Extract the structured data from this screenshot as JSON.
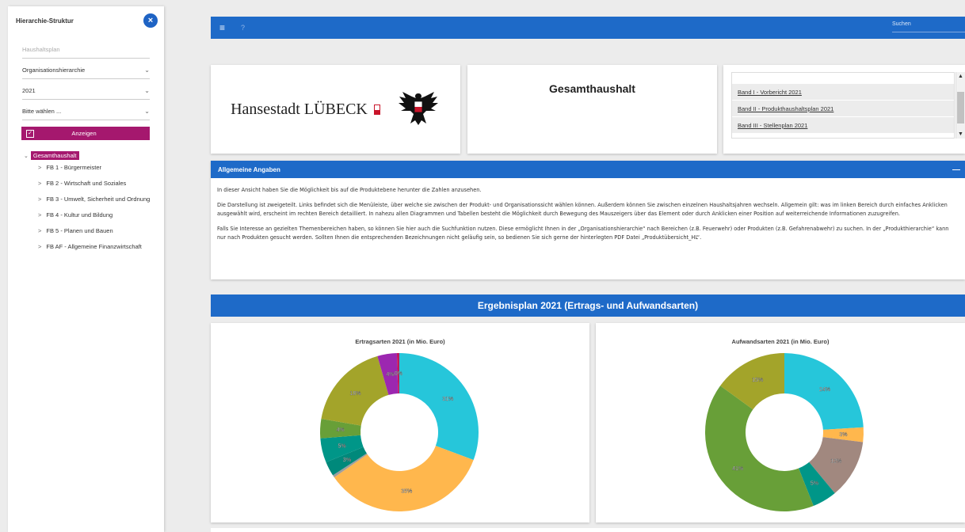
{
  "sidebar": {
    "title": "Hierarchie-Struktur",
    "close_icon": "×",
    "placeholder_field": "Haushaltsplan",
    "hierarchy_select": "Organisationshierarchie",
    "year_select": "2021",
    "choice_select": "Bitte wählen ...",
    "show_button": "Anzeigen",
    "tree_root": "Gesamthaushalt",
    "tree_items": [
      "FB 1 - Bürgermeister",
      "FB 2 - Wirtschaft und Soziales",
      "FB 3 - Umwelt, Sicherheit und Ordnung",
      "FB 4 - Kultur und Bildung",
      "FB 5 - Planen und Bauen",
      "FB AF - Allgemeine Finanzwirtschaft"
    ]
  },
  "topbar": {
    "menu_icon": "≡",
    "help_icon": "?",
    "search_placeholder": "Suchen"
  },
  "logo": {
    "text": "Hansestadt LÜBECK"
  },
  "title_card": {
    "title": "Gesamthaushalt"
  },
  "bands": [
    "Band I - Vorbericht 2021",
    "Band II - Produkthaushaltsplan 2021",
    "Band III - Stellenplan 2021"
  ],
  "info": {
    "header": "Allgemeine Angaben",
    "minimize": "—",
    "p1": "In dieser Ansicht haben Sie die Möglichkeit bis auf die Produktebene herunter die Zahlen anzusehen.",
    "p2": "Die Darstellung ist zweigeteilt. Links befindet sich die Menüleiste, über welche sie zwischen der Produkt- und Organisationssicht wählen können. Außerdem können Sie zwischen einzelnen Haushaltsjahren wechseln. Allgemein gilt: was im linken Bereich durch einfaches Anklicken ausgewählt wird, erscheint im rechten Bereich detailliert. In nahezu allen Diagrammen und Tabellen besteht die Möglichkeit durch Bewegung des Mauszeigers über das Element oder durch Anklicken einer Position auf weiterreichende Informationen zuzugreifen.",
    "p3": "Falls Sie Interesse an gezielten Themenbereichen haben, so können Sie hier auch die Suchfunktion nutzen. Diese ermöglicht Ihnen in der „Organisationshierarchie“ nach Bereichen (z.B. Feuerwehr) oder Produkten (z.B. Gefahrenabwehr) zu suchen. In der „Produkthierarchie“ kann nur nach Produkten gesucht werden. Sollten Ihnen die entsprechenden Bezeichnungen nicht geläufig sein, so bedienen Sie sich gerne der hinterlegten PDF Datei „Produktübersicht_HL“."
  },
  "section_title": "Ergebnisplan 2021 (Ertrags- und Aufwandsarten)",
  "colors": {
    "accent": "#1e6ac8",
    "brand": "#a5186e"
  },
  "chart_data": [
    {
      "type": "pie",
      "title": "Ertragsarten 2021 (in Mio. Euro)",
      "donut": true,
      "slices": [
        {
          "value": 31,
          "label": "31%",
          "color": "#26c6da"
        },
        {
          "value": 35,
          "label": "35%",
          "color": "#ffb74d"
        },
        {
          "value": 0.5,
          "label": "",
          "color": "#9e9e9e"
        },
        {
          "value": 3,
          "label": "3%",
          "color": "#00897b"
        },
        {
          "value": 5,
          "label": "5%",
          "color": "#009688"
        },
        {
          "value": 4,
          "label": "4%",
          "color": "#689f38"
        },
        {
          "value": 18,
          "label": "18%",
          "color": "#a3a42a"
        },
        {
          "value": 4,
          "label": "4%",
          "color": "#9c27b0"
        },
        {
          "value": 0.5,
          "label": "0%",
          "color": "#c2185b"
        }
      ]
    },
    {
      "type": "pie",
      "title": "Aufwandsarten 2021 (in Mio. Euro)",
      "donut": true,
      "slices": [
        {
          "value": 24,
          "label": "24%",
          "color": "#26c6da"
        },
        {
          "value": 3,
          "label": "3%",
          "color": "#ffb74d"
        },
        {
          "value": 12,
          "label": "12%",
          "color": "#a1887f"
        },
        {
          "value": 5,
          "label": "5%",
          "color": "#009688"
        },
        {
          "value": 41,
          "label": "41%",
          "color": "#689f38"
        },
        {
          "value": 15,
          "label": "15%",
          "color": "#a3a42a"
        }
      ]
    }
  ]
}
